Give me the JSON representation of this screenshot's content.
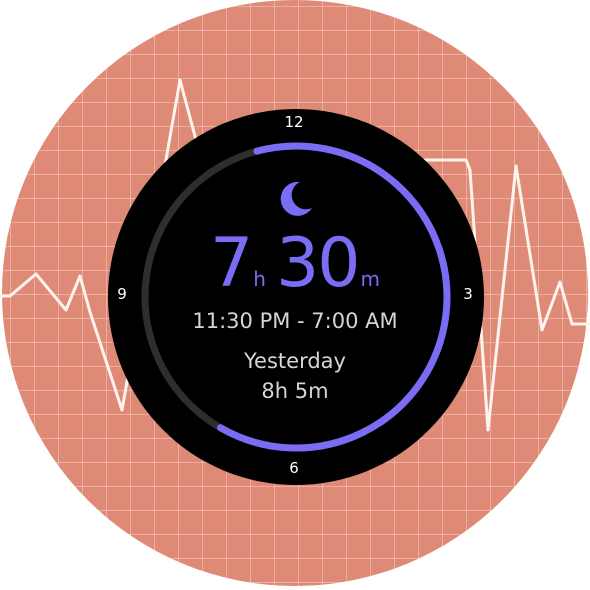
{
  "dial": {
    "ticks": {
      "top": "12",
      "right": "3",
      "bottom": "6",
      "left": "9"
    }
  },
  "sleep": {
    "icon": "moon-icon",
    "hours": "7",
    "hours_unit": "h",
    "minutes": "30",
    "minutes_unit": "m",
    "range": "11:30 PM - 7:00 AM",
    "progress_start_hour": 11.5,
    "progress_end_hour": 7.0
  },
  "previous": {
    "label": "Yesterday",
    "value": "8h 5m"
  },
  "colors": {
    "background": "#df8a76",
    "dial": "#000000",
    "accent": "#7b6cf5",
    "track": "#2e2e2e",
    "ecg_line": "#fff3ee"
  }
}
